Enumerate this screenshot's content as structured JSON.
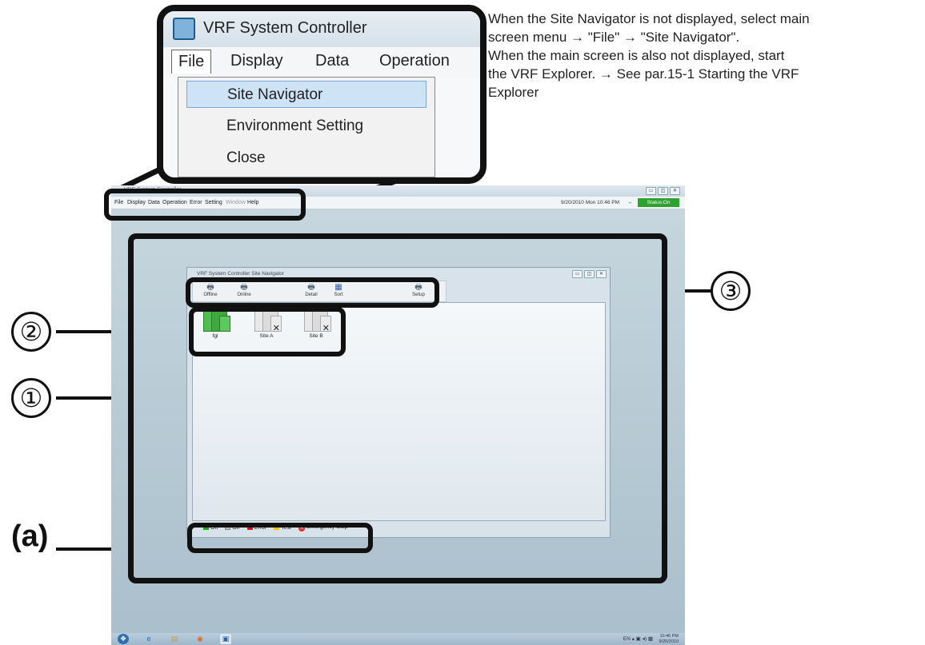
{
  "zoom": {
    "app_title": "VRF System Controller",
    "menu": [
      "File",
      "Display",
      "Data",
      "Operation"
    ],
    "dropdown": [
      "Site Navigator",
      "Environment Setting",
      "Close"
    ]
  },
  "main_window": {
    "title": "VRF System Controller",
    "menu": [
      "File",
      "Display",
      "Data",
      "Operation",
      "Error",
      "Setting",
      "Window",
      "Help"
    ],
    "datetime": "9/20/2010 Mon 10:46 PM",
    "status": "Status:On",
    "window_buttons": [
      "▭",
      "◫",
      "✕"
    ]
  },
  "site_navigator": {
    "title": "VRF System Controller Site Navigator",
    "toolbar": [
      "Offline",
      "Online",
      "Detail",
      "Sort",
      "Setup"
    ],
    "sites": [
      {
        "name": "fgl",
        "color": "#3caa3c"
      },
      {
        "name": "Site A",
        "color": "#d9d9d9"
      },
      {
        "name": "Site B",
        "color": "#d9d9d9"
      }
    ],
    "legend": [
      {
        "label": "On",
        "color": "#22aa22"
      },
      {
        "label": "Off",
        "color": "#bbbbbb"
      },
      {
        "label": "Error",
        "color": "#dd1111"
      },
      {
        "label": "Test",
        "color": "#f0c419"
      },
      {
        "label": "Emergency Stop",
        "color": "#dd3333"
      }
    ],
    "estop_glyph": "✕"
  },
  "taskbar": {
    "lang": "EN",
    "time": "10:46 PM",
    "date": "9/20/2010"
  },
  "callout_numbers": [
    "③",
    "②",
    "①"
  ],
  "callout_a": "(a)",
  "description": [
    "When the Site Navigator is not displayed, select main",
    "screen menu → \"File\" → \"Site Navigator\".",
    "When the main screen is also not displayed, start",
    "the VRF Explorer.  → See par.15-1 Starting the VRF",
    "Explorer"
  ]
}
